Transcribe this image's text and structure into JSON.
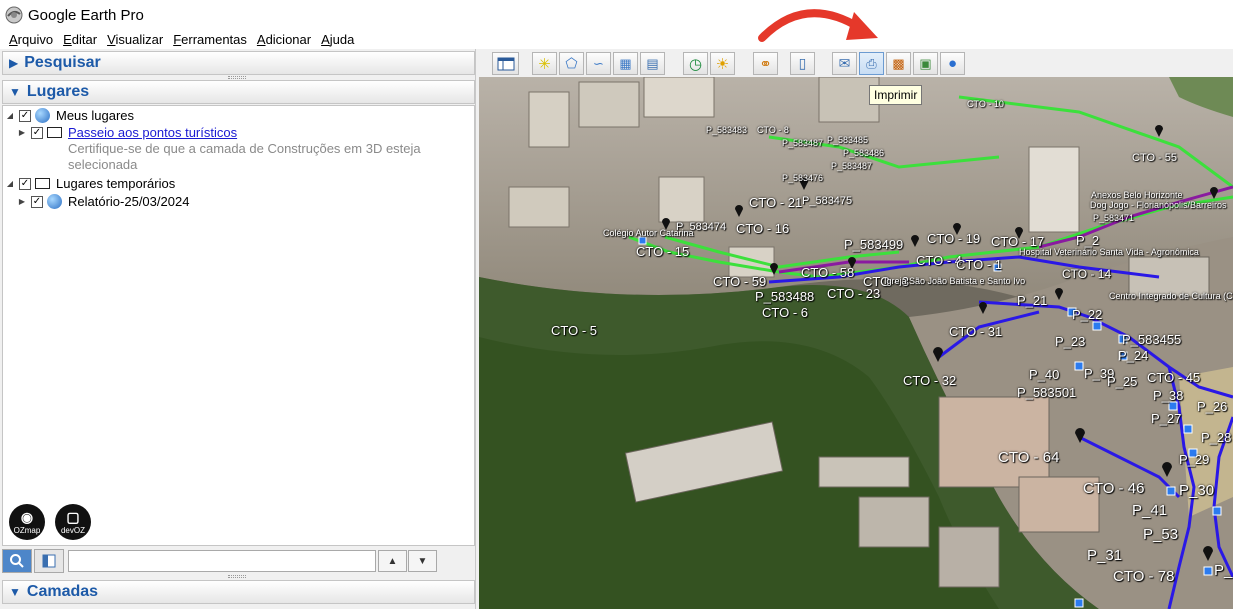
{
  "window": {
    "title": "Google Earth Pro"
  },
  "menu": {
    "items": [
      {
        "first": "A",
        "rest": "rquivo"
      },
      {
        "first": "E",
        "rest": "ditar"
      },
      {
        "first": "V",
        "rest": "isualizar"
      },
      {
        "first": "F",
        "rest": "erramentas"
      },
      {
        "first": "A",
        "rest": "dicionar"
      },
      {
        "first": "A",
        "rest": "juda"
      }
    ]
  },
  "panels": {
    "search_title": "Pesquisar",
    "places_title": "Lugares",
    "layers_title": "Camadas"
  },
  "places": {
    "my_places": "Meus lugares",
    "tour_link": "Passeio aos pontos turísticos",
    "tour_note_line1": "Certifique-se de que a camada de Construções em 3D esteja",
    "tour_note_line2": "selecionada",
    "temp_places": "Lugares temporários",
    "report": "Relatório-25/03/2024"
  },
  "logos": {
    "ozmap": "OZmap",
    "devoz_prefix": "dev",
    "devoz_suffix": "OZ"
  },
  "toolbar": {
    "tooltip": "Imprimir"
  },
  "colors": {
    "accent": "#1d5aa8",
    "route_green": "#3ce03c",
    "route_blue": "#2a18e6",
    "route_purple": "#8a1aa0",
    "arrow_red": "#e5382a"
  },
  "map": {
    "labels": {
      "cto10": "CTO - 10",
      "p583483": "P_583483",
      "cto_x": "CTO - 8",
      "p583485": "P_583485",
      "p583487": "P_583487",
      "p583486": "P_583486",
      "p583487b": "P_583487",
      "p583476": "P_583476",
      "cto55": "CTO - 55",
      "cto21": "CTO - 21",
      "p583475": "P_583475",
      "p583474": "P_583474",
      "cto16": "CTO - 16",
      "cto15": "CTO - 15",
      "p583499": "P_583499",
      "cto19": "CTO - 19",
      "cto17": "CTO - 17",
      "p2": "P_2",
      "p583471": "P_583471",
      "cto4": "CTO - 4",
      "cto1": "CTO - 1",
      "cto14": "CTO - 14",
      "cto58": "CTO - 58",
      "cto59": "CTO - 59",
      "cto23": "CTO - 23",
      "cto3": "CTO - 3",
      "p583488": "P_583488",
      "cto6": "CTO - 6",
      "cto5": "CTO - 5",
      "p21": "P_21",
      "p22": "P_22",
      "cto31": "CTO - 31",
      "p23": "P_23",
      "p583455": "P_583455",
      "p24": "P_24",
      "cto32": "CTO - 32",
      "p40": "P_40",
      "p39": "P_39",
      "p25": "P_25",
      "cto45": "CTO - 45",
      "p583501": "P_583501",
      "p38": "P_38",
      "p26": "P_26",
      "p27": "P_27",
      "p28": "P_28",
      "cto64": "CTO - 64",
      "p29": "P_29",
      "cto46": "CTO - 46",
      "p30": "P_30",
      "p41": "P_41",
      "p53": "P_53",
      "p31": "P_31",
      "cto78": "CTO - 78",
      "p_cut": "P_",
      "poi_hospital": "Hospital Veterinário Santa Vida - Agronômica",
      "poi_igreja": "Igreja São João Batista e Santo Ivo",
      "poi_centro": "Centro Integrado de Cultura (CIC)",
      "poi_colegio": "Colégio Autor Catarina",
      "poi_dog": "Dog Jogo - Florianópolis/Barreiros",
      "poi_aneis": "Anexos Belo Horizonte"
    }
  }
}
